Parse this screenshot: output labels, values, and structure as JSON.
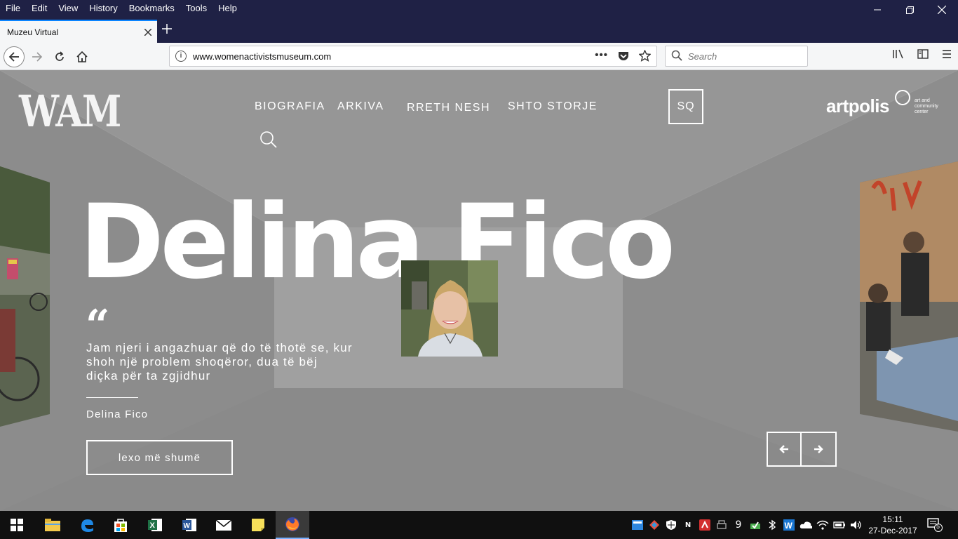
{
  "browser": {
    "menu": [
      "File",
      "Edit",
      "View",
      "History",
      "Bookmarks",
      "Tools",
      "Help"
    ],
    "tab_title": "Muzeu Virtual",
    "url": "www.womenactivistsmuseum.com",
    "search_placeholder": "Search"
  },
  "site": {
    "logo": "WAM",
    "nav": [
      "BIOGRAFIA",
      "ARKIVA",
      "RRETH NESH",
      "SHTO STORJE"
    ],
    "lang": "SQ",
    "partner_logo": "artpolis",
    "partner_tagline": "art and community center"
  },
  "hero": {
    "title": "Delina Fico",
    "quote_mark": "“",
    "quote": "Jam njeri i angazhuar që do të thotë se, kur shoh një problem shoqëror, dua të bëj diçka për ta zgjidhur",
    "author": "Delina Fico",
    "cta": "lexo më shumë"
  },
  "taskbar": {
    "tray_count": "9",
    "time": "15:11",
    "date": "27-Dec-2017",
    "notifications": "5"
  },
  "colors": {
    "titlebar": "#1f2145",
    "page_bg": "#8f8f8f",
    "taskbar": "#101010",
    "accent": "#0a84ff"
  }
}
